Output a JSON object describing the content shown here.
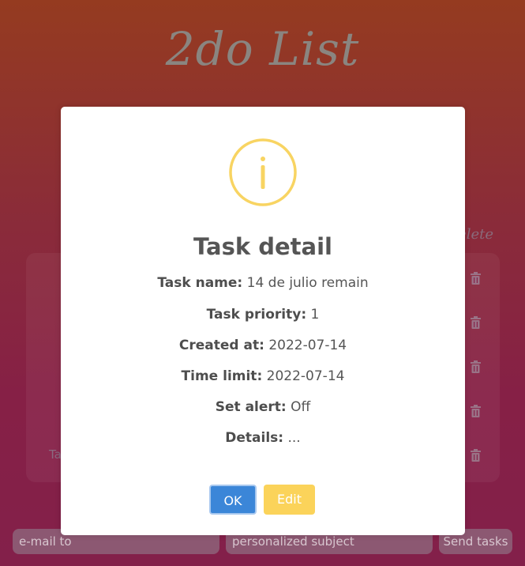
{
  "app": {
    "title": "2do List",
    "delete_column": "elete",
    "row_partial": "Ta"
  },
  "modal": {
    "title": "Task detail",
    "icon": "info-icon",
    "icon_color": "#f8d462",
    "fields": [
      {
        "label": "Task name:",
        "value": "14 de julio remain"
      },
      {
        "label": "Task priority:",
        "value": "1"
      },
      {
        "label": "Created at:",
        "value": "2022-07-14"
      },
      {
        "label": "Time limit:",
        "value": "2022-07-14"
      },
      {
        "label": "Set alert:",
        "value": "Off"
      },
      {
        "label": "Details:",
        "value": "..."
      }
    ],
    "ok_label": "OK",
    "edit_label": "Edit",
    "ok_color": "#3b86d8",
    "edit_color": "#fbd35a"
  },
  "bottom": {
    "email_placeholder": "e-mail to",
    "subject_placeholder": "personalized subject",
    "send_label": "Send tasks"
  }
}
